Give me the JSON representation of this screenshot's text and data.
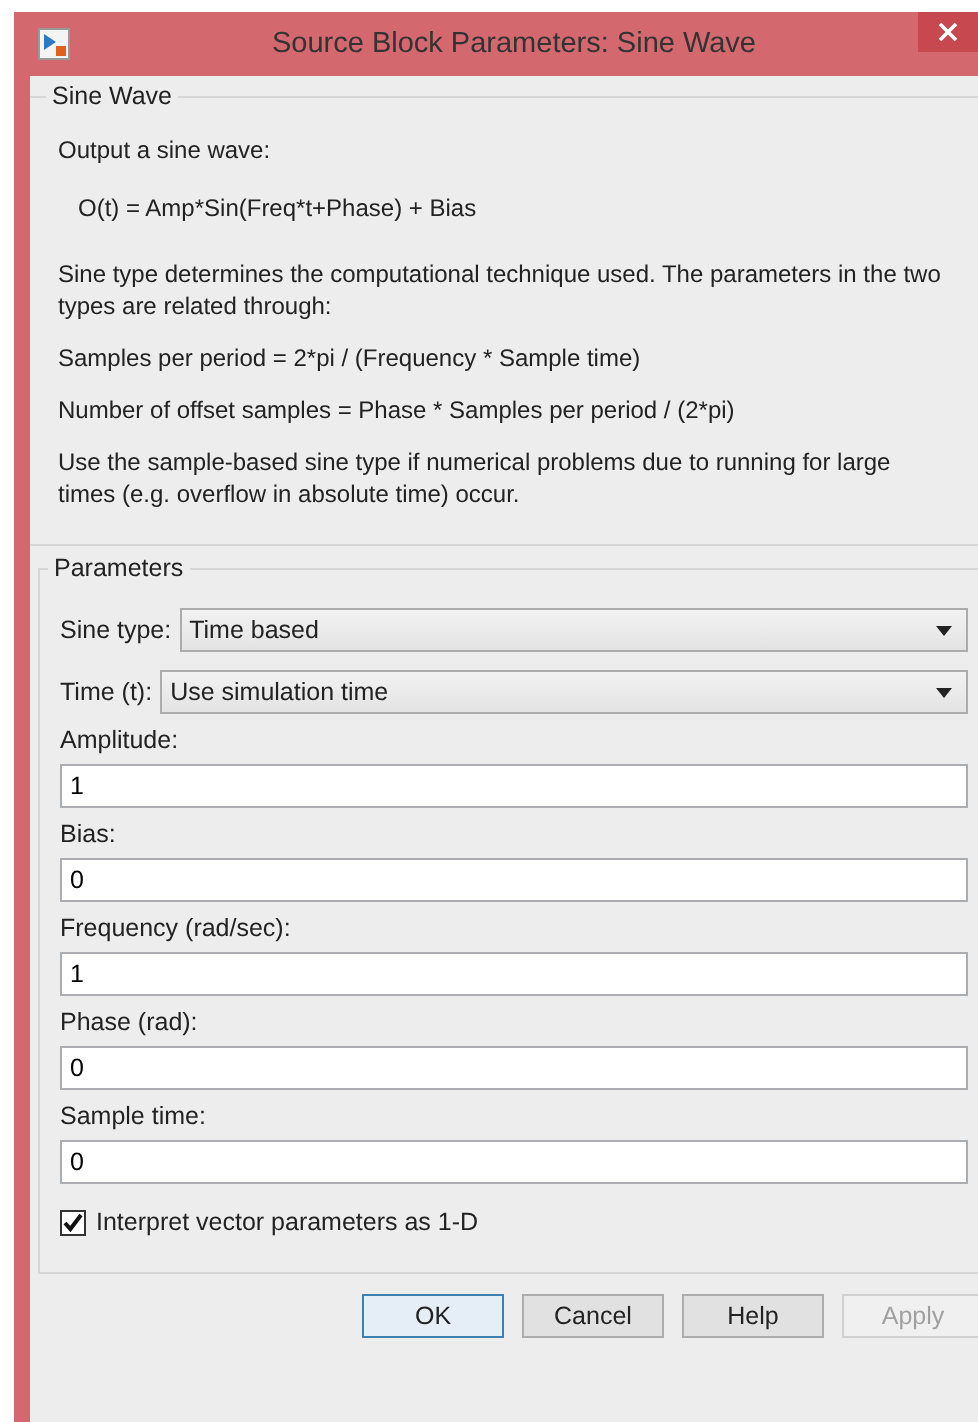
{
  "window": {
    "title": "Source Block Parameters: Sine Wave"
  },
  "description": {
    "title": "Sine Wave",
    "paragraphs": [
      {
        "kind": "text",
        "text": "Output a sine wave:"
      },
      {
        "kind": "formula",
        "text": "O(t) = Amp*Sin(Freq*t+Phase) + Bias"
      },
      {
        "kind": "text",
        "text": "Sine type determines the computational technique used. The parameters in the two types are related through:"
      },
      {
        "kind": "text",
        "text": "Samples per period = 2*pi / (Frequency * Sample time)"
      },
      {
        "kind": "text",
        "text": "Number of offset samples = Phase * Samples per period / (2*pi)"
      },
      {
        "kind": "text",
        "text": "Use the sample-based sine type if numerical problems due to running for large times (e.g. overflow in absolute time) occur."
      }
    ]
  },
  "parameters": {
    "title": "Parameters",
    "dropdowns": [
      {
        "label": "Sine type:",
        "value": "Time based"
      },
      {
        "label": "Time (t):",
        "value": "Use simulation time"
      }
    ],
    "fields": [
      {
        "label": "Amplitude:",
        "value": "1"
      },
      {
        "label": "Bias:",
        "value": "0"
      },
      {
        "label": "Frequency (rad/sec):",
        "value": "1"
      },
      {
        "label": "Phase (rad):",
        "value": "0"
      },
      {
        "label": "Sample time:",
        "value": "0"
      }
    ],
    "checkbox": {
      "label": "Interpret vector parameters as 1-D",
      "checked": true
    }
  },
  "buttons": [
    {
      "label": "OK",
      "default": true,
      "disabled": false
    },
    {
      "label": "Cancel",
      "default": false,
      "disabled": false
    },
    {
      "label": "Help",
      "default": false,
      "disabled": false
    },
    {
      "label": "Apply",
      "default": false,
      "disabled": true
    }
  ]
}
